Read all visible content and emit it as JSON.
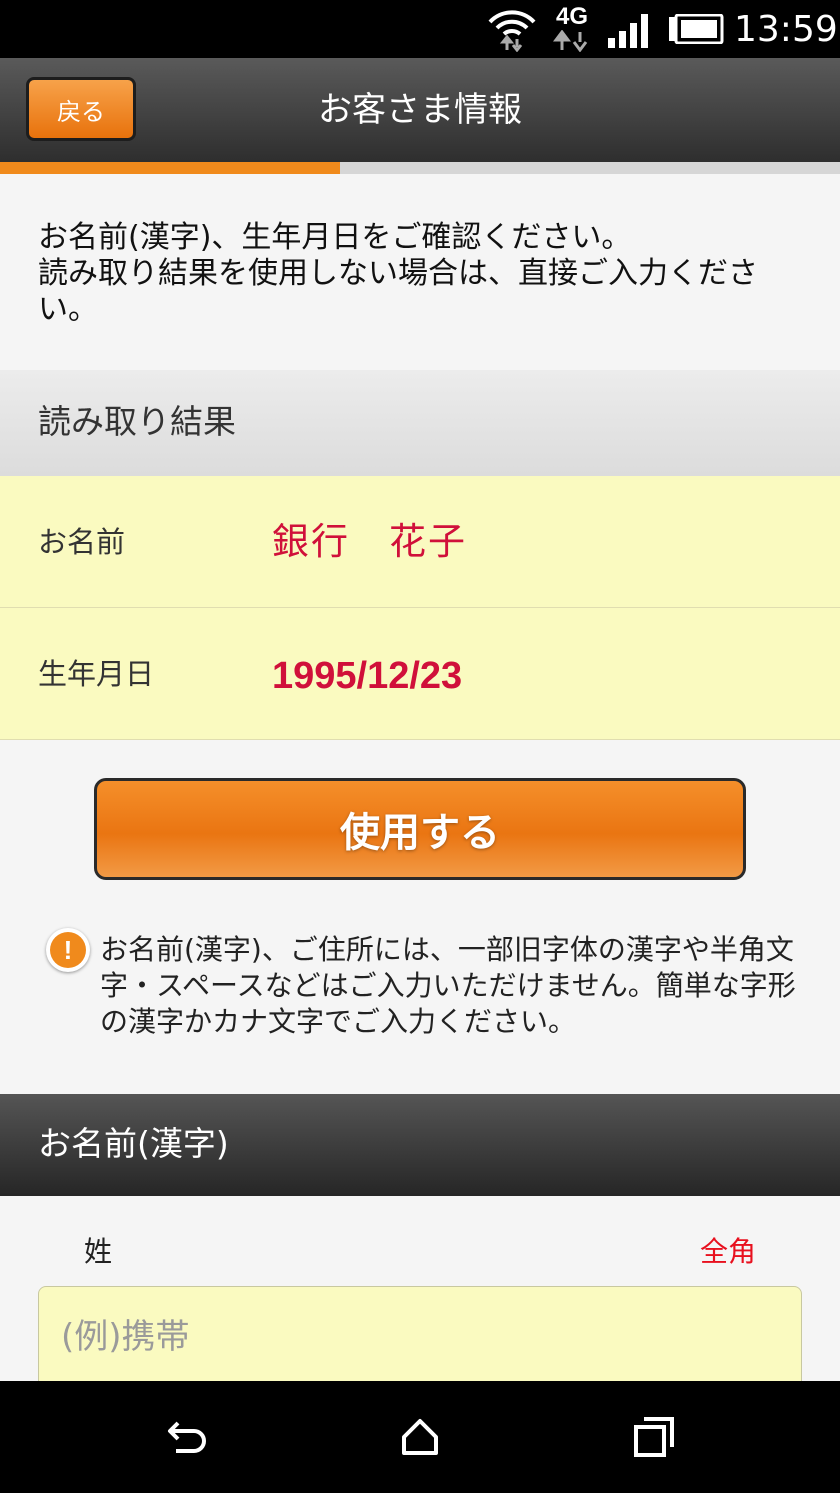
{
  "status_bar": {
    "time": "13:59",
    "icons": [
      "wifi-icon",
      "4g-icon",
      "signal-icon",
      "battery-icon"
    ],
    "network_label": "4G"
  },
  "header": {
    "back_label": "戻る",
    "title": "お客さま情報"
  },
  "progress": {
    "fraction": 0.405
  },
  "intro": {
    "line1": "お名前(漢字)、生年月日をご確認ください。",
    "line2": "読み取り結果を使用しない場合は、直接ご入力ください。"
  },
  "scan_result": {
    "header": "読み取り結果",
    "name_label": "お名前",
    "name_value": "銀行　花子",
    "dob_label": "生年月日",
    "dob_value": "1995/12/23"
  },
  "use_button_label": "使用する",
  "notice": {
    "icon": "!",
    "text": "お名前(漢字)、ご住所には、一部旧字体の漢字や半角文字・スペースなどはご入力いただけません。簡単な字形の漢字かカナ文字でご入力ください。"
  },
  "name_section": {
    "header": "お名前(漢字)",
    "surname_label": "姓",
    "surname_hint": "全角",
    "surname_placeholder": "(例)携帯",
    "surname_value": ""
  },
  "colors": {
    "accent": "#f08a1c",
    "highlight_bg": "#fafac0",
    "value_red": "#d0103a",
    "hint_red": "#e8101e"
  },
  "nav_bar": {
    "icons": [
      "back-icon",
      "home-icon",
      "recents-icon"
    ]
  }
}
